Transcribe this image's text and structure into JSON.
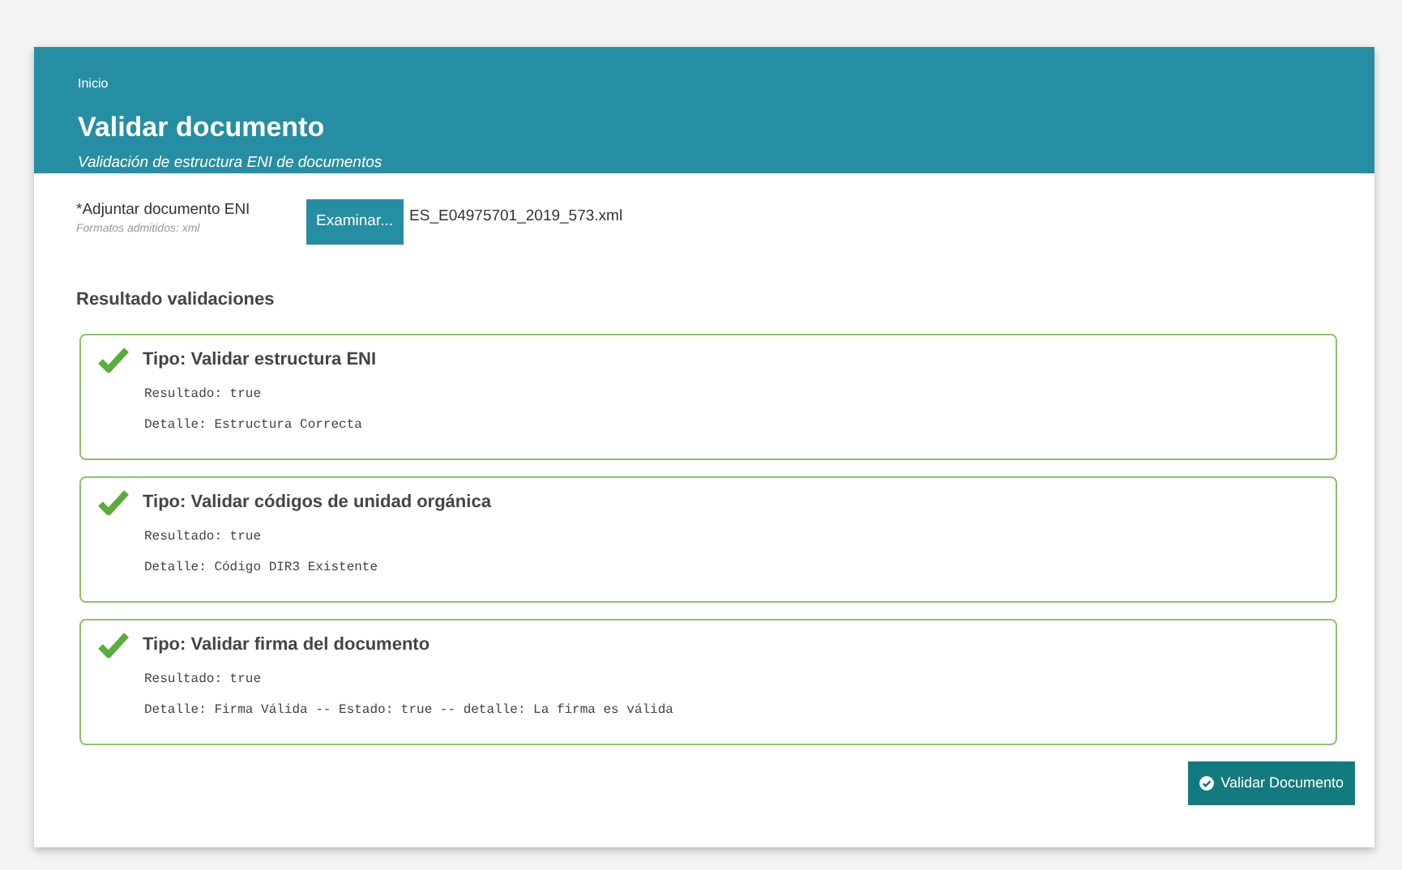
{
  "header": {
    "breadcrumb": "Inicio",
    "title": "Validar documento",
    "subtitle": "Validación de estructura ENI de documentos"
  },
  "file_input": {
    "label": "*Adjuntar documento ENI",
    "hint": "Formatos admitidos: xml",
    "button": "Examinar...",
    "value": "ES_E04975701_2019_573.xml"
  },
  "results_heading": "Resultado validaciones",
  "results": [
    {
      "ok": true,
      "title": "Tipo: Validar estructura ENI",
      "lines": [
        "Resultado: true",
        "Detalle: Estructura Correcta"
      ]
    },
    {
      "ok": true,
      "title": "Tipo: Validar códigos de unidad orgánica",
      "lines": [
        "Resultado: true",
        "Detalle: Código DIR3 Existente"
      ]
    },
    {
      "ok": true,
      "title": "Tipo: Validar firma del documento",
      "lines": [
        "Resultado: true",
        "Detalle: Firma Válida -- Estado: true -- detalle: La firma es válida"
      ]
    }
  ],
  "submit_button": "Validar Documento"
}
